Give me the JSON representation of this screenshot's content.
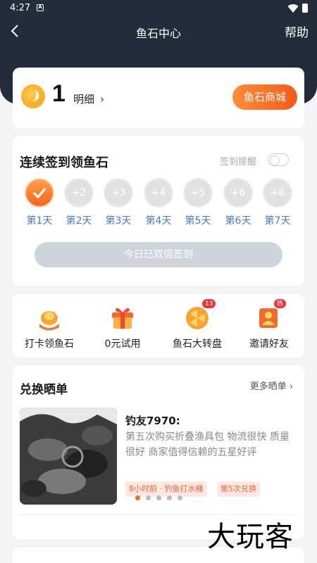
{
  "status_bar": {
    "time": "4:27"
  },
  "nav": {
    "title": "鱼石中心",
    "help": "帮助"
  },
  "balance": {
    "amount": "1",
    "detail": "明细",
    "mall_button": "鱼石商城"
  },
  "checkin": {
    "title": "连续签到领鱼石",
    "reminder_label": "签到提醒",
    "days": [
      {
        "reward": "",
        "label": "第1天",
        "done": true
      },
      {
        "reward": "+2",
        "label": "第2天",
        "done": false
      },
      {
        "reward": "+3",
        "label": "第3天",
        "done": false
      },
      {
        "reward": "+4",
        "label": "第4天",
        "done": false
      },
      {
        "reward": "+5",
        "label": "第5天",
        "done": false
      },
      {
        "reward": "+6",
        "label": "第6天",
        "done": false
      },
      {
        "reward": "+8",
        "label": "第7天",
        "done": false
      }
    ],
    "signed_button": "今日已双倍签到"
  },
  "tools": [
    {
      "label": "打卡领鱼石",
      "icon": "fish-icon",
      "badge": ""
    },
    {
      "label": "0元试用",
      "icon": "gift-icon",
      "badge": ""
    },
    {
      "label": "鱼石大转盘",
      "icon": "wheel-icon",
      "badge": "13"
    },
    {
      "label": "邀请好友",
      "icon": "invite-icon",
      "badge": "热"
    }
  ],
  "share": {
    "title": "兑换晒单",
    "more": "更多晒单",
    "user": "钓友7970:",
    "text": "第五次购买折叠渔具包 物流很快 质量很好 商家值得信赖的五星好评",
    "tag_time": "8小时前 · 钓鱼打水桶",
    "tag_count": "第5次兑换",
    "dots_total": 5,
    "dots_active": 0
  },
  "watermark": "大玩客",
  "colors": {
    "accent": "#f25a1c",
    "header": "#222c3a",
    "day_label": "#4a78c8"
  }
}
